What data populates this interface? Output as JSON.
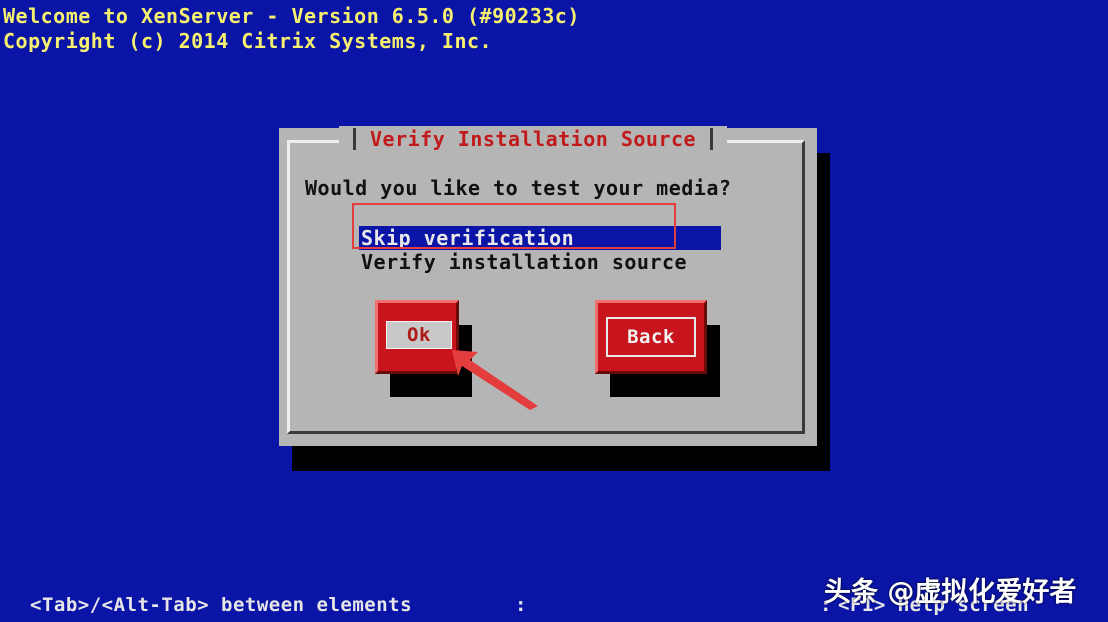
{
  "console": {
    "line1": "Welcome to XenServer - Version 6.5.0 (#90233c)",
    "line2": "Copyright (c) 2014 Citrix Systems, Inc."
  },
  "dialog": {
    "title": "Verify Installation Source",
    "question": "Would you like to test your media?",
    "options": [
      {
        "label": "Skip verification",
        "selected": true
      },
      {
        "label": "Verify installation source",
        "selected": false
      }
    ],
    "buttons": {
      "ok": "Ok",
      "back": "Back"
    }
  },
  "statusbar": {
    "left": "<Tab>/<Alt-Tab> between elements",
    "sep": ":",
    "right": "<F1> Help screen"
  },
  "watermark": "头条 @虚拟化爱好者",
  "colors": {
    "background": "#0a14a6",
    "dialog": "#b5b5b5",
    "title_red": "#c21a1a",
    "button_red": "#c8141c",
    "console_yellow": "#f6f06e",
    "annotation_red": "#e43d3d"
  },
  "icons": {
    "annotation": "arrow-pointer-icon"
  }
}
